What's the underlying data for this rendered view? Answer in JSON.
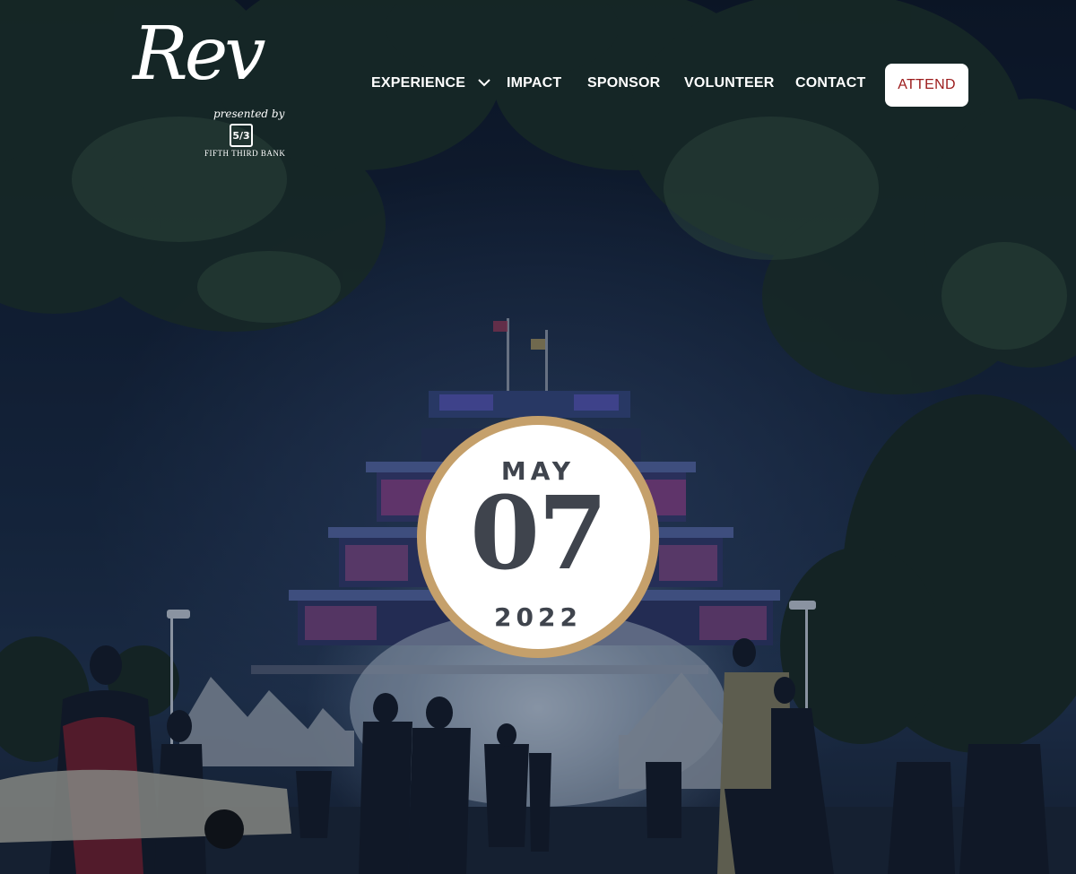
{
  "logo": {
    "wordmark": "Rev",
    "presented_by": "presented by",
    "bank_mark": "5/3",
    "bank_name": "FIFTH THIRD BANK"
  },
  "nav": {
    "items": [
      {
        "label": "EXPERIENCE",
        "has_dropdown": true,
        "icon": "chevron-down-icon"
      },
      {
        "label": "IMPACT"
      },
      {
        "label": "SPONSOR"
      },
      {
        "label": "VOLUNTEER"
      },
      {
        "label": "CONTACT"
      }
    ],
    "cta_label": "ATTEND"
  },
  "event_date": {
    "month": "MAY",
    "day": "07",
    "year": "2022"
  },
  "colors": {
    "badge_ring": "#c5a06b",
    "badge_text": "#3f444d",
    "cta_text": "#9c1b1b",
    "nav_text": "#ffffff"
  }
}
